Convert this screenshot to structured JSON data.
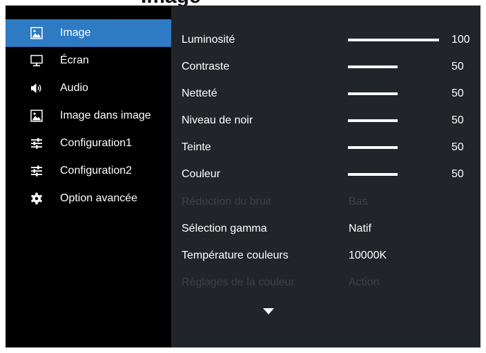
{
  "menu": [
    {
      "label": "Image",
      "icon": "picture-icon",
      "active": true
    },
    {
      "label": "Écran",
      "icon": "monitor-icon",
      "active": false
    },
    {
      "label": "Audio",
      "icon": "speaker-icon",
      "active": false
    },
    {
      "label": "Image dans image",
      "icon": "picture-in-picture-icon",
      "active": false
    },
    {
      "label": "Configuration1",
      "icon": "sliders-icon",
      "active": false
    },
    {
      "label": "Configuration2",
      "icon": "sliders-icon",
      "active": false
    },
    {
      "label": "Option avancée",
      "icon": "gear-icon",
      "active": false
    }
  ],
  "settings": [
    {
      "label": "Luminosité",
      "level": 100,
      "value": "100"
    },
    {
      "label": "Contraste",
      "level": 50,
      "value": "50"
    },
    {
      "label": "Netteté",
      "level": 50,
      "value": "50"
    },
    {
      "label": "Niveau de noir",
      "level": 50,
      "value": "50"
    },
    {
      "label": "Teinte",
      "level": 50,
      "value": "50"
    },
    {
      "label": "Couleur",
      "level": 50,
      "value": "50"
    },
    {
      "label": "Réduction du bruit",
      "value": "Bas",
      "disabled": true
    },
    {
      "label": "Sélection gamma",
      "value": "Natif"
    },
    {
      "label": "Température couleurs",
      "value": "10000K"
    },
    {
      "label": "Réglages de la couleur",
      "value": "Action",
      "disabled": true
    }
  ],
  "colors": {
    "osd_bg": "#000000",
    "panel_bg": "#212529",
    "active": "#2e7bc4",
    "disabled_text": "#3a4149"
  },
  "scroll_indicator": "chevron-down-icon"
}
